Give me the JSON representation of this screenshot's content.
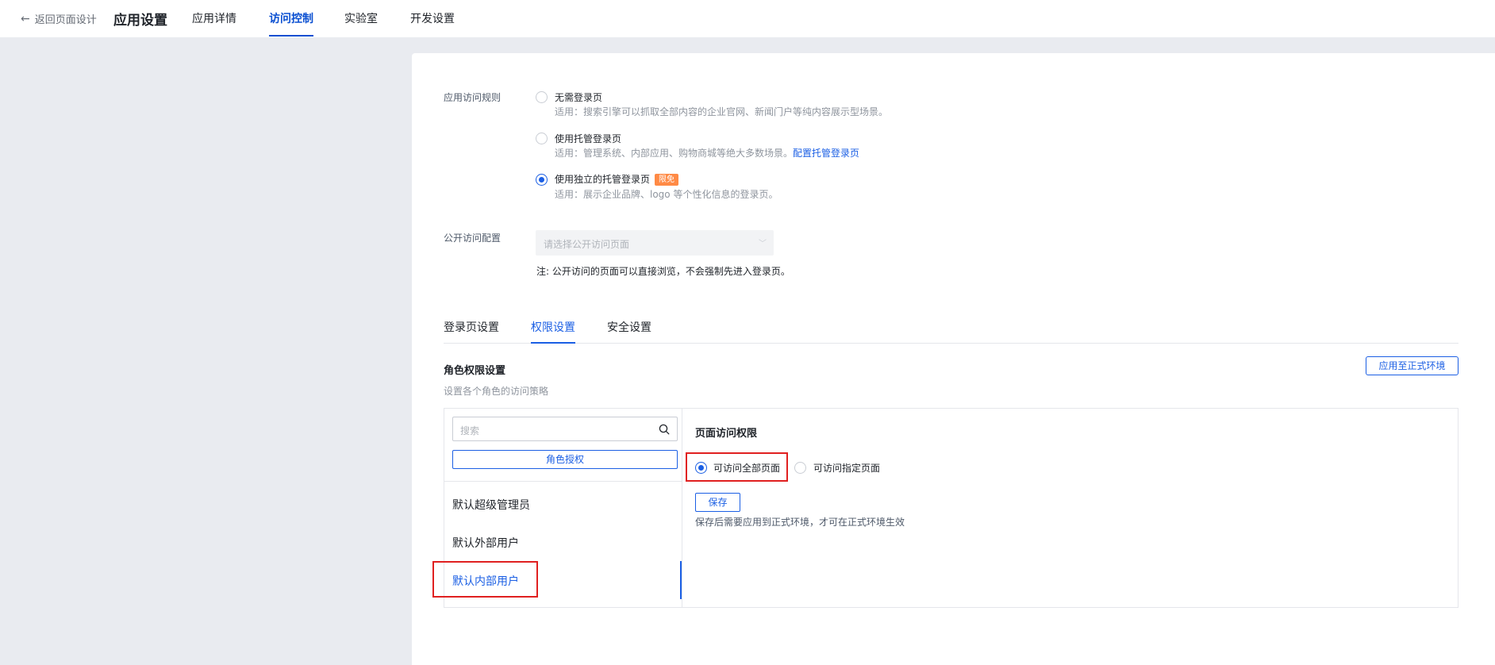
{
  "header": {
    "back_label": "返回页面设计",
    "title": "应用设置",
    "tabs": [
      {
        "label": "应用详情"
      },
      {
        "label": "访问控制"
      },
      {
        "label": "实验室"
      },
      {
        "label": "开发设置"
      }
    ],
    "active_tab": "访问控制"
  },
  "access_rule": {
    "label": "应用访问规则",
    "options": [
      {
        "title": "无需登录页",
        "desc": "适用：搜索引擎可以抓取全部内容的企业官网、新闻门户等纯内容展示型场景。"
      },
      {
        "title": "使用托管登录页",
        "desc": "适用：管理系统、内部应用、购物商城等绝大多数场景。",
        "link": "配置托管登录页"
      },
      {
        "title": "使用独立的托管登录页",
        "badge": "限免",
        "desc": "适用：展示企业品牌、logo 等个性化信息的登录页。"
      }
    ],
    "selected": "使用独立的托管登录页"
  },
  "public_access": {
    "label": "公开访问配置",
    "placeholder": "请选择公开访问页面",
    "note": "注: 公开访问的页面可以直接浏览，不会强制先进入登录页。"
  },
  "sub_tabs": [
    {
      "label": "登录页设置"
    },
    {
      "label": "权限设置"
    },
    {
      "label": "安全设置"
    }
  ],
  "active_sub_tab": "权限设置",
  "role_settings": {
    "title": "角色权限设置",
    "subtitle": "设置各个角色的访问策略",
    "apply_button": "应用至正式环境",
    "search_placeholder": "搜索",
    "role_auth_button": "角色授权",
    "roles": [
      {
        "name": "默认超级管理员"
      },
      {
        "name": "默认外部用户"
      },
      {
        "name": "默认内部用户"
      }
    ],
    "selected_role": "默认内部用户"
  },
  "page_permission": {
    "title": "页面访问权限",
    "options": [
      {
        "label": "可访问全部页面"
      },
      {
        "label": "可访问指定页面"
      }
    ],
    "selected": "可访问全部页面",
    "save_button": "保存",
    "save_note": "保存后需要应用到正式环境，才可在正式环境生效"
  },
  "colors": {
    "accent": "#1b5fe4",
    "nav_active": "#0a4fd1",
    "badge": "#ff8a45",
    "highlight": "#e02020",
    "page_bg": "#e9ebf0"
  }
}
